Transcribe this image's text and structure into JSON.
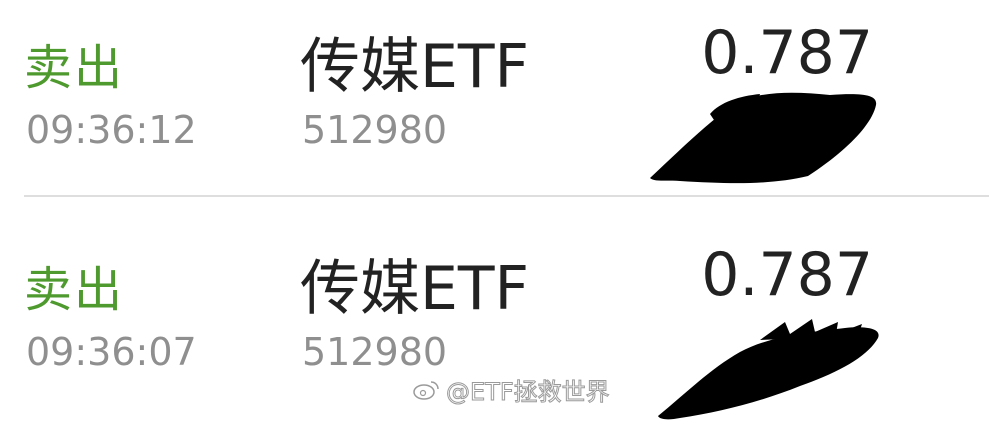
{
  "trades": [
    {
      "action": "卖出",
      "time": "09:36:12",
      "name": "传媒ETF",
      "code": "512980",
      "price": "0.787"
    },
    {
      "action": "卖出",
      "time": "09:36:07",
      "name": "传媒ETF",
      "code": "512980",
      "price": "0.787"
    }
  ],
  "watermark": {
    "text": "@ETF拯救世界",
    "icon": "weibo-icon"
  },
  "colors": {
    "sell": "#4f9a2f",
    "primary_text": "#222222",
    "secondary_text": "#8f8f8f",
    "divider": "#dedede"
  }
}
